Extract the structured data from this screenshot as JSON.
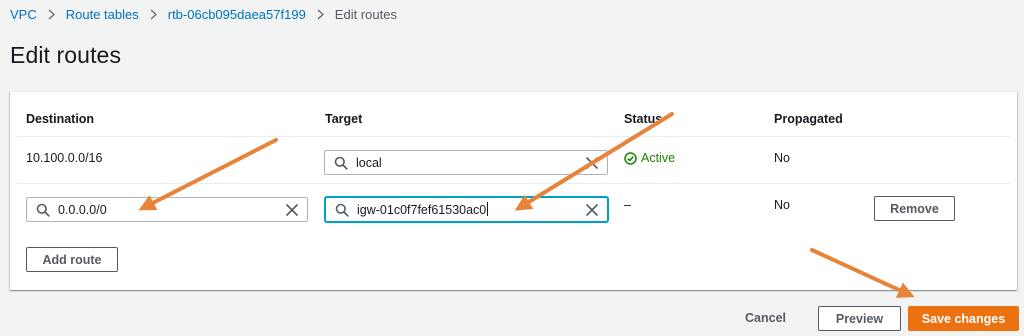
{
  "breadcrumb": {
    "items": [
      "VPC",
      "Route tables",
      "rtb-06cb095daea57f199"
    ],
    "current": "Edit routes"
  },
  "page": {
    "title": "Edit routes"
  },
  "table": {
    "columns": {
      "destination": "Destination",
      "target": "Target",
      "status": "Status",
      "propagated": "Propagated"
    },
    "rows": [
      {
        "destination": "10.100.0.0/16",
        "target": "local",
        "status": "Active",
        "propagated": "No"
      },
      {
        "destination": "0.0.0.0/0",
        "target": "igw-01c0f7fef61530ac0",
        "status": "–",
        "propagated": "No",
        "remove_label": "Remove"
      }
    ]
  },
  "actions": {
    "add_route": "Add route",
    "cancel": "Cancel",
    "preview": "Preview",
    "save": "Save changes"
  },
  "colors": {
    "link": "#0073bb",
    "primary": "#ec7211",
    "success": "#1d8102",
    "focus": "#00a1c9",
    "annotation_arrow": "#e8833a"
  },
  "icons": [
    "chevron-right-icon",
    "search-icon",
    "clear-icon",
    "status-success-icon",
    "annotation-arrow"
  ]
}
